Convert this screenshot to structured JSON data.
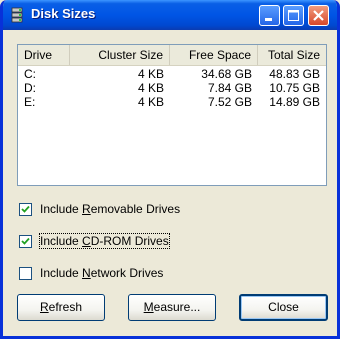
{
  "window": {
    "title": "Disk Sizes"
  },
  "listview": {
    "columns": [
      "Drive",
      "Cluster Size",
      "Free Space",
      "Total Size"
    ],
    "rows": [
      {
        "drive": "C:",
        "cluster": "4 KB",
        "free": "34.68 GB",
        "total": "48.83 GB"
      },
      {
        "drive": "D:",
        "cluster": "4 KB",
        "free": "7.84 GB",
        "total": "10.75 GB"
      },
      {
        "drive": "E:",
        "cluster": "4 KB",
        "free": "7.52 GB",
        "total": "14.89 GB"
      }
    ]
  },
  "options": {
    "removable": {
      "pre": "Include ",
      "key": "R",
      "post": "emovable Drives",
      "checked": true
    },
    "cdrom": {
      "pre": "Include ",
      "key": "C",
      "post": "D-ROM Drives",
      "checked": true
    },
    "network": {
      "pre": "Include ",
      "key": "N",
      "post": "etwork Drives",
      "checked": false
    }
  },
  "buttons": {
    "refresh": {
      "key": "R",
      "post": "efresh"
    },
    "measure": {
      "key": "M",
      "post": "easure..."
    },
    "close": "Close"
  },
  "colors": {
    "titlebar": "#0055e5",
    "window_bg": "#ece9d8",
    "close_button": "#d8482a"
  },
  "icons": {
    "app": "drive-stack-icon",
    "minimize": "minimize-icon",
    "maximize": "maximize-icon",
    "close": "close-icon"
  }
}
